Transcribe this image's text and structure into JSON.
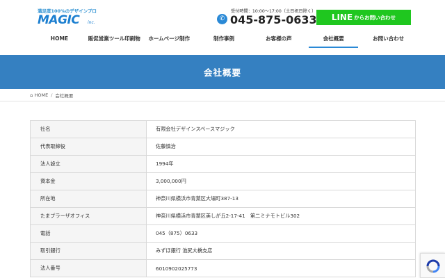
{
  "header": {
    "tagline": "満足度100%のデザインプロ",
    "logo_text": "MAGIC",
    "logo_sub": "inc.",
    "phone_hours": "受付時間：10:00～17:00（土日祝日除く）",
    "phone_number": "045-875-0633",
    "line_word": "LINE",
    "line_rest": "からお問い合わせ"
  },
  "nav": {
    "items": [
      {
        "label": "HOME"
      },
      {
        "label": "販促営業ツール印刷物"
      },
      {
        "label": "ホームページ制作"
      },
      {
        "label": "制作事例"
      },
      {
        "label": "お客様の声"
      },
      {
        "label": "会社概要"
      },
      {
        "label": "お問い合わせ"
      }
    ],
    "active_index": 5
  },
  "hero": {
    "title": "会社概要"
  },
  "breadcrumb": {
    "home": "HOME",
    "separator": "/",
    "current": "会社概要"
  },
  "company": {
    "rows": [
      {
        "key": "社名",
        "value": "有限会社デザインスペースマジック"
      },
      {
        "key": "代表取締役",
        "value": "佐藤慎治"
      },
      {
        "key": "法人設立",
        "value": "1994年"
      },
      {
        "key": "資本金",
        "value": "3,000,000円"
      },
      {
        "key": "所在地",
        "value": "神奈川県横浜市青葉区大場町387-13"
      },
      {
        "key": "たまプラーザオフィス",
        "value": "神奈川県横浜市青葉区美しが丘2-17-41　第二ミナモトビル302"
      },
      {
        "key": "電話",
        "value": "045（875）0633"
      },
      {
        "key": "取引銀行",
        "value": "みずほ銀行 池尻大橋支店"
      },
      {
        "key": "法人番号",
        "value": "6010902025773"
      }
    ]
  },
  "colors": {
    "brand_blue": "#3580c1",
    "line_green": "#1fc71f",
    "logo_blue": "#1c7fd0"
  }
}
